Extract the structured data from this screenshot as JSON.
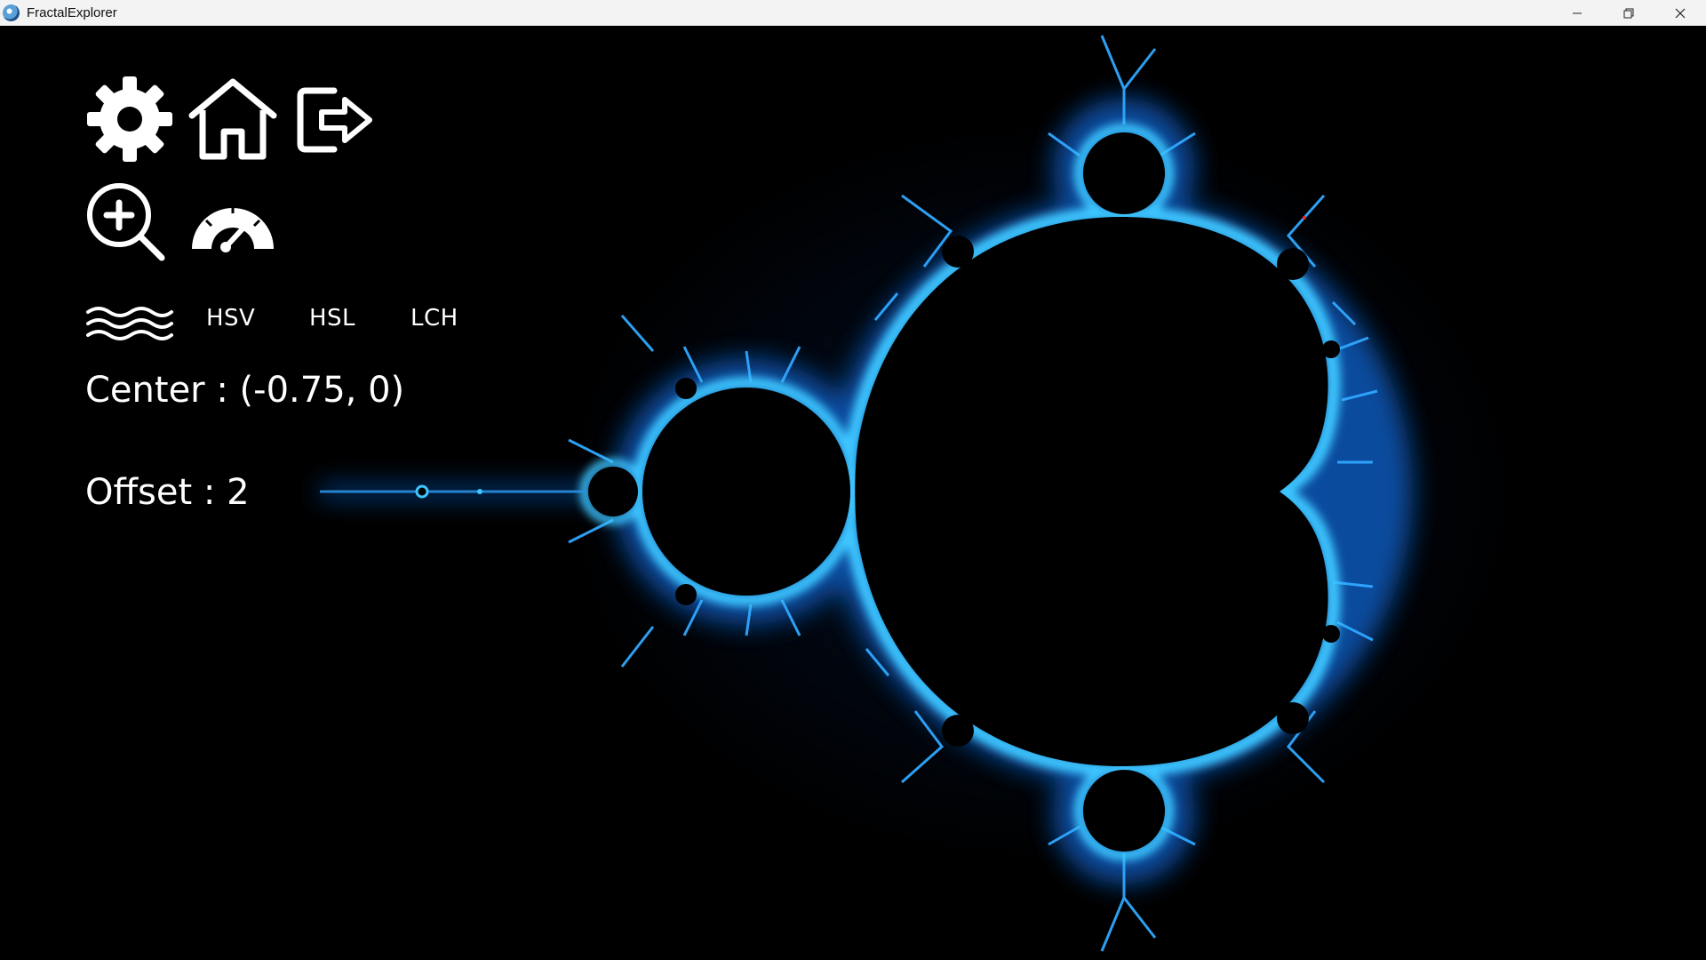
{
  "window": {
    "title": "FractalExplorer",
    "controls": {
      "minimize_icon": "minimize-icon",
      "restore_icon": "restore-icon",
      "close_icon": "close-icon"
    }
  },
  "toolbar": {
    "row1": [
      {
        "name": "settings",
        "icon": "gear-icon"
      },
      {
        "name": "home",
        "icon": "home-icon"
      },
      {
        "name": "exit",
        "icon": "exit-icon"
      }
    ],
    "row2": [
      {
        "name": "zoom",
        "icon": "zoom-in-icon"
      },
      {
        "name": "speed",
        "icon": "speedometer-icon"
      }
    ]
  },
  "color_modes": {
    "waves_icon": "waves-icon",
    "hsv": "HSV",
    "hsl": "HSL",
    "lch": "LCH"
  },
  "info": {
    "center": "Center : (-0.75, 0)",
    "offset": "Offset : 2"
  },
  "colors": {
    "background": "#000000",
    "fractal_glow": "#1e90ff",
    "fractal_edge": "#40e0d0",
    "ui_text": "#ffffff",
    "titlebar": "#f3f3f3"
  }
}
